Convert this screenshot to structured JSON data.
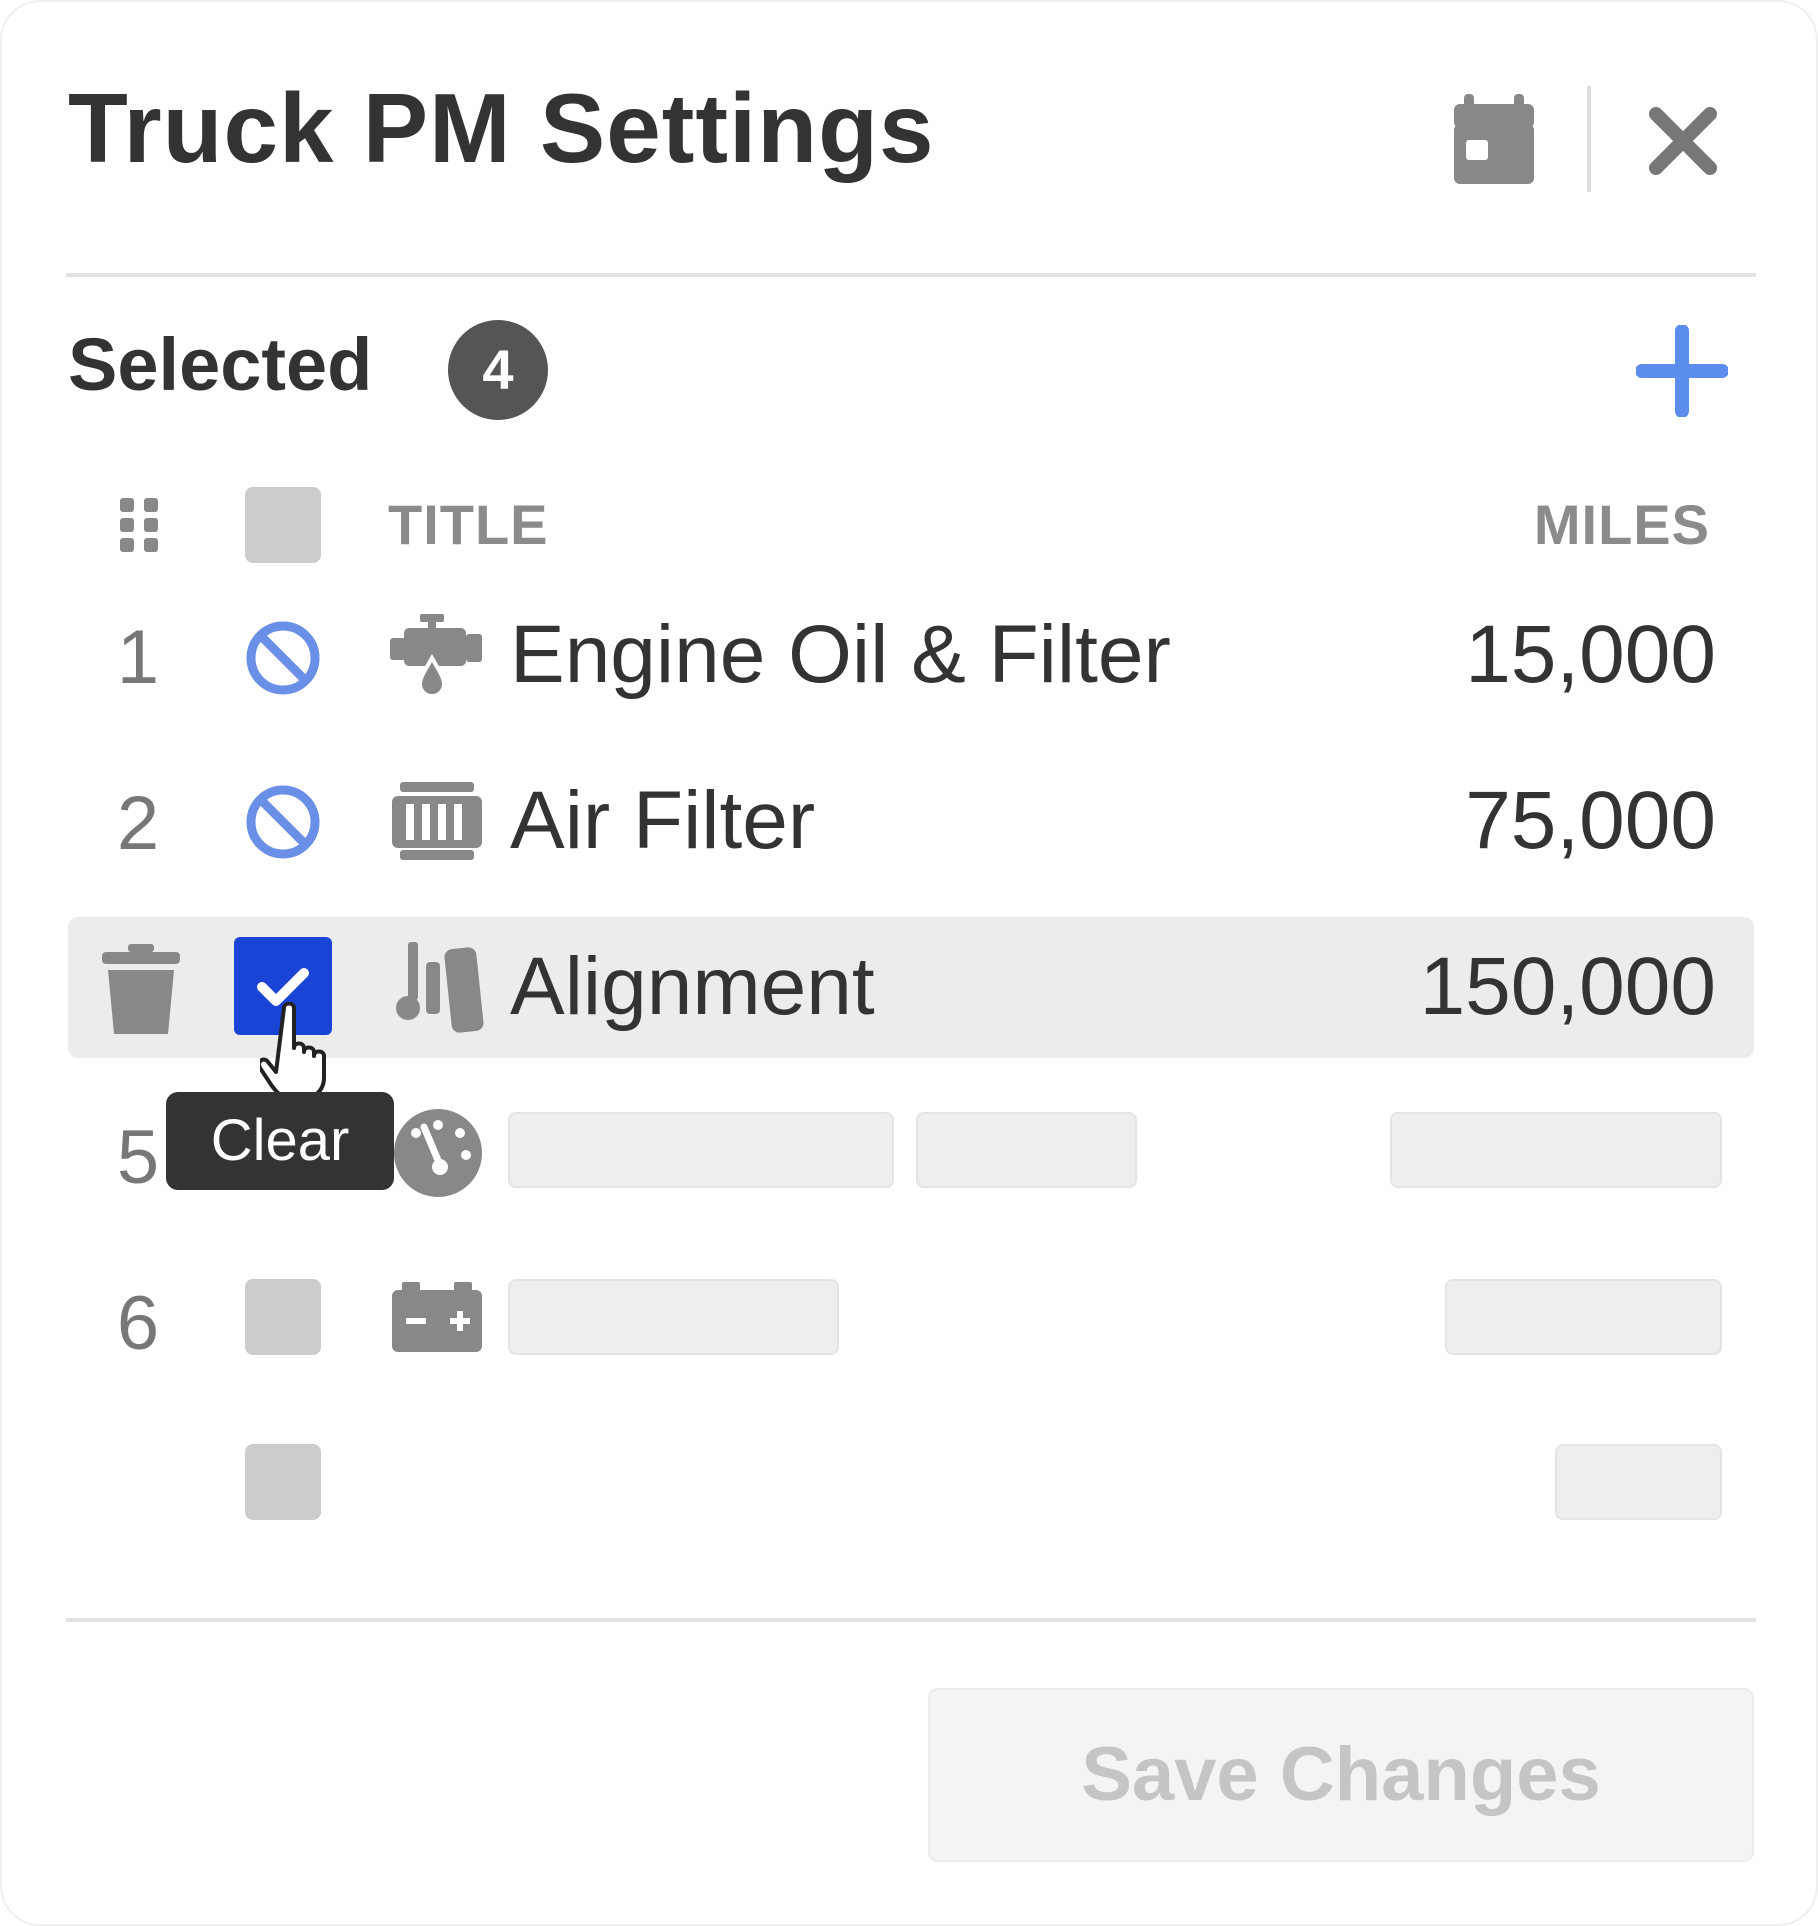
{
  "header": {
    "title": "Truck PM Settings",
    "calendar_icon": "calendar-icon",
    "close_icon": "close-icon"
  },
  "selection": {
    "label": "Selected",
    "count": "4",
    "add_icon": "plus-icon"
  },
  "columns": {
    "title": "TITLE",
    "miles": "MILES"
  },
  "rows": [
    {
      "num": "1",
      "status": "disabled",
      "icon": "engine-oil-icon",
      "title": "Engine Oil & Filter",
      "miles": "15,000"
    },
    {
      "num": "2",
      "status": "disabled",
      "icon": "air-filter-icon",
      "title": "Air Filter",
      "miles": "75,000"
    },
    {
      "num": "",
      "status": "checked",
      "icon": "alignment-icon",
      "title": "Alignment",
      "miles": "150,000",
      "action_icon": "trash-icon"
    },
    {
      "num": "5",
      "status": "loading",
      "icon": "gauge-icon",
      "title": "",
      "miles": ""
    },
    {
      "num": "6",
      "status": "loading",
      "icon": "battery-icon",
      "title": "",
      "miles": ""
    },
    {
      "num": "",
      "status": "loading",
      "icon": "",
      "title": "",
      "miles": ""
    }
  ],
  "tooltip": "Clear",
  "footer": {
    "save_label": "Save Changes"
  },
  "colors": {
    "accent": "#1a44d6",
    "plus": "#5b8def",
    "disabled_icon": "#6a8fe6",
    "text": "#333333"
  }
}
